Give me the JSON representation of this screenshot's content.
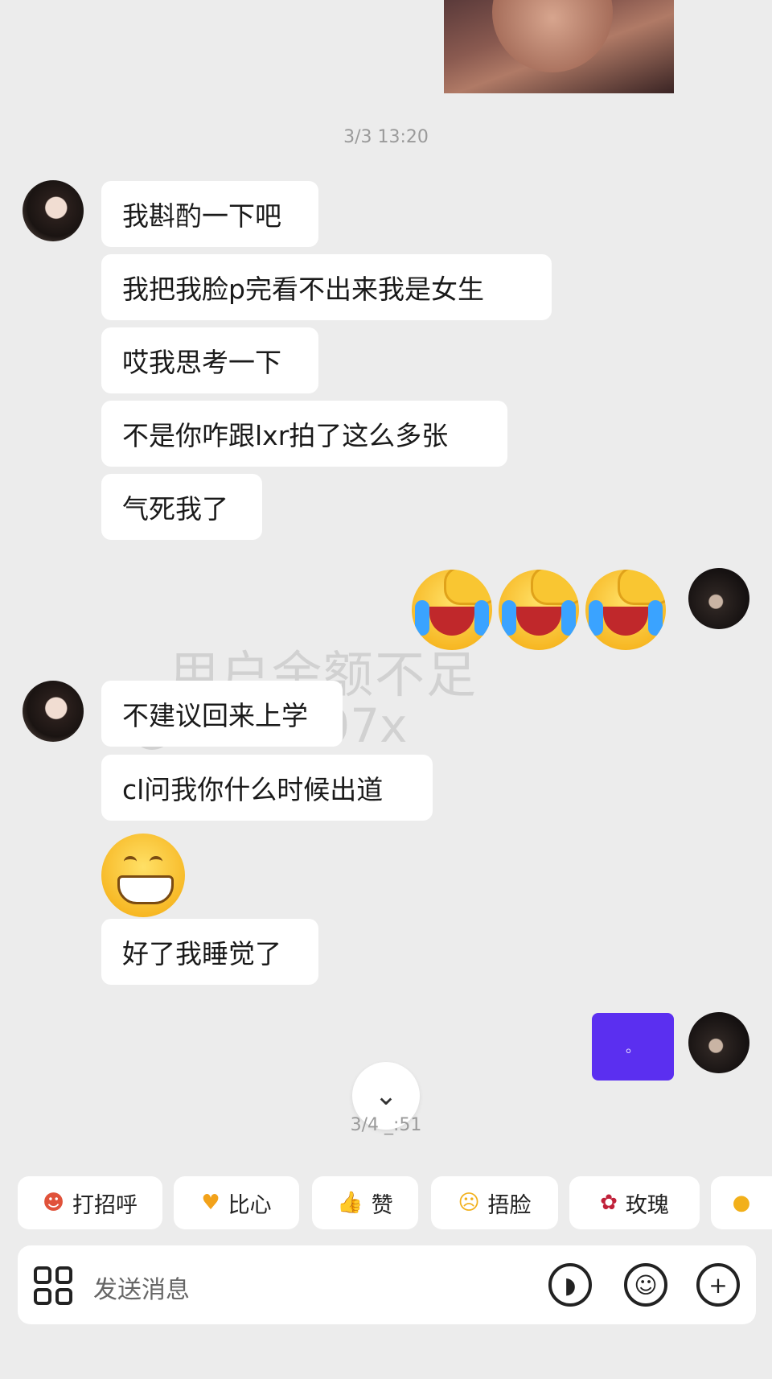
{
  "chat": {
    "timestamps": [
      "3/3 13:20",
      "3/4 _:51"
    ],
    "messages_incoming_1": [
      "我斟酌一下吧",
      "我把我脸p完看不出来我是女生",
      "哎我思考一下",
      "不是你咋跟lxr拍了这么多张",
      "气死我了"
    ],
    "messages_incoming_2": [
      "不建议回来上学",
      "cl问我你什么时候出道",
      "好了我睡觉了"
    ],
    "purple_bubble_text": "。",
    "watermark": [
      "用户余额不足",
      "@xuan207x"
    ]
  },
  "quick_replies": [
    {
      "label": "打招呼",
      "icon": "wave-emoji-icon"
    },
    {
      "label": "比心",
      "icon": "heart-hands-emoji-icon"
    },
    {
      "label": "赞",
      "icon": "thumbs-up-emoji-icon"
    },
    {
      "label": "捂脸",
      "icon": "facepalm-emoji-icon"
    },
    {
      "label": "玫瑰",
      "icon": "rose-emoji-icon"
    }
  ],
  "input": {
    "placeholder": "发送消息"
  },
  "icons": {
    "scroll_down": "double-chevron-down-icon",
    "voice": "voice-icon",
    "emoji": "smile-icon",
    "add": "plus-icon"
  },
  "colors": {
    "background": "#ececec",
    "bubble": "#ffffff",
    "purple_bubble": "#5b2ff0"
  }
}
